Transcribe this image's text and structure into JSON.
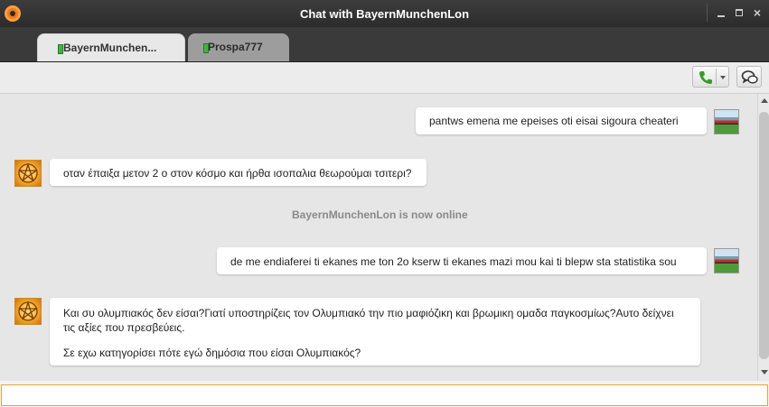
{
  "window": {
    "title": "Chat with BayernMunchenLon",
    "controls": [
      "minimize-icon",
      "maximize-icon",
      "close-icon"
    ],
    "close_glyph": "×"
  },
  "tabs": [
    {
      "label": "BayernMunchen...",
      "active": true,
      "status": "online"
    },
    {
      "label": "Prospa777",
      "active": false,
      "status": "online"
    }
  ],
  "toolbar": {
    "call_icon": "phone-icon",
    "call_menu_icon": "chevron-down-icon",
    "chat_toggle_icon": "chat-bubbles-icon"
  },
  "messages": [
    {
      "from": "self",
      "avatar": "photo",
      "lines": [
        "pantws emena me epeises oti eisai sigoura cheateri"
      ]
    },
    {
      "from": "other",
      "avatar": "pentagram",
      "lines": [
        "οταν έπαιξα μετον 2 ο στον κόσμο και ήρθα ισοπαλια θεωρούμαι τσιτερι?"
      ]
    },
    {
      "from": "system",
      "text": "BayernMunchenLon is now online"
    },
    {
      "from": "self",
      "avatar": "photo",
      "lines": [
        "de me endiaferei ti ekanes me ton 2o kserw ti ekanes mazi mou kai ti blepw sta statistika sou"
      ]
    },
    {
      "from": "other",
      "avatar": "pentagram",
      "lines": [
        "Και συ ολυμπιακός δεν είσαι?Γιατί υποστηρίζεις τον Ολυμπιακό την πιο μαφιόζικη και βρωμικη ομαδα παγκοσμίως?Αυτο δείχνει",
        "τις αξίες που πρεσβεύεις.",
        "Σε εχω κατηγορίσει πότε εγώ δημόσια που είσαι Ολυμπιακός?"
      ]
    }
  ],
  "input": {
    "value": "",
    "placeholder": ""
  },
  "colors": {
    "titlebar": "#2e2e2e",
    "tabstrip": "#3a3a3a",
    "online": "#3fb43f",
    "accent": "#f07a1c",
    "input_border": "#e7a43a"
  }
}
